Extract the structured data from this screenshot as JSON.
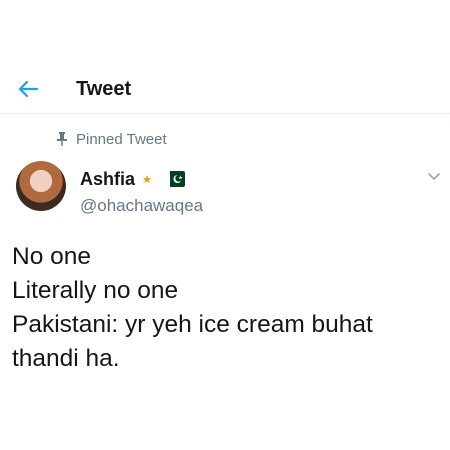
{
  "header": {
    "title": "Tweet",
    "accent": "#1da1f2"
  },
  "pinned": {
    "label": "Pinned Tweet"
  },
  "author": {
    "display_name": "Ashfia",
    "handle": "@ohachawaqea",
    "emoji_icons": [
      "star-moon-icon",
      "pakistan-flag-icon"
    ]
  },
  "tweet": {
    "lines": [
      "No one",
      "Literally no one",
      "Pakistani: yr yeh ice cream buhat",
      "thandi ha."
    ]
  },
  "colors": {
    "text_primary": "#14171a",
    "text_secondary": "#657786",
    "divider": "#e6ecf0"
  }
}
